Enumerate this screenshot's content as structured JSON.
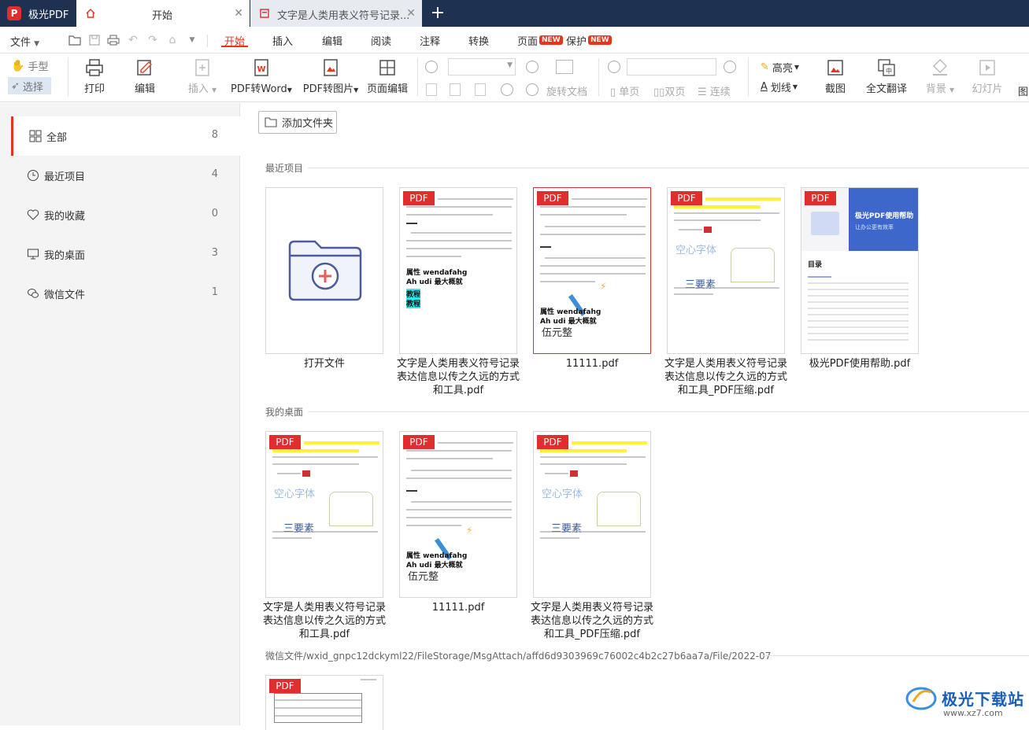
{
  "app": {
    "name": "极光PDF"
  },
  "tabs": [
    {
      "label": "开始"
    },
    {
      "label": "文字是人类用表义符号记录..."
    }
  ],
  "menubar": {
    "file": "文件",
    "tabs": [
      "开始",
      "插入",
      "编辑",
      "阅读",
      "注释",
      "转换",
      "页面",
      "保护"
    ],
    "new_badge": "NEW"
  },
  "toolbar": {
    "hand": "手型",
    "select": "选择",
    "print": "打印",
    "edit": "编辑",
    "insert": "插入",
    "pdf_to_word": "PDF转Word",
    "pdf_to_image": "PDF转图片",
    "page_edit": "页面编辑",
    "rotate_doc": "旋转文档",
    "single_page": "单页",
    "double_page": "双页",
    "continuous": "连续",
    "highlight": "高亮",
    "underline": "划线",
    "screenshot": "截图",
    "full_translate": "全文翻译",
    "background": "背景",
    "slideshow": "幻灯片",
    "more": "图"
  },
  "sidebar": {
    "items": [
      {
        "label": "全部",
        "count": "8"
      },
      {
        "label": "最近项目",
        "count": "4"
      },
      {
        "label": "我的收藏",
        "count": "0"
      },
      {
        "label": "我的桌面",
        "count": "3"
      },
      {
        "label": "微信文件",
        "count": "1"
      }
    ]
  },
  "content": {
    "add_folder": "添加文件夹",
    "pdf_tag": "PDF",
    "sections": [
      {
        "title": "最近项目",
        "cards": [
          {
            "name": "打开文件"
          },
          {
            "name": "文字是人类用表义符号记录表达信息以传之久远的方式和工具.pdf"
          },
          {
            "name": "11111.pdf"
          },
          {
            "name": "文字是人类用表义符号记录表达信息以传之久远的方式和工具_PDF压缩.pdf"
          },
          {
            "name": "极光PDF使用帮助.pdf"
          }
        ]
      },
      {
        "title": "我的桌面",
        "cards": [
          {
            "name": "文字是人类用表义符号记录表达信息以传之久远的方式和工具.pdf"
          },
          {
            "name": "11111.pdf"
          },
          {
            "name": "文字是人类用表义符号记录表达信息以传之久远的方式和工具_PDF压缩.pdf"
          }
        ]
      },
      {
        "title": "微信文件/wxid_gnpc12dckyml22/FileStorage/MsgAttach/affd6d9303969c76002c4b2c27b6aa7a/File/2022-07",
        "cards": []
      }
    ],
    "page_text": {
      "bold1": "属性 wendafahg",
      "bold2": "Ah udi 最大概就",
      "tag1": "教程",
      "tag2": "教程",
      "hollow": "空心字体",
      "three": "三要素",
      "yuan": "伍元整",
      "help_title": "极光PDF使用帮助",
      "help_sub": "让办公更有效率",
      "help_toc": "目录"
    }
  },
  "watermark": {
    "text": "极光下载站",
    "url": "www.xz7.com"
  },
  "colors": {
    "accent": "#e8341c",
    "titlebar": "#1e3150",
    "pdf_tag": "#e02d2d"
  }
}
